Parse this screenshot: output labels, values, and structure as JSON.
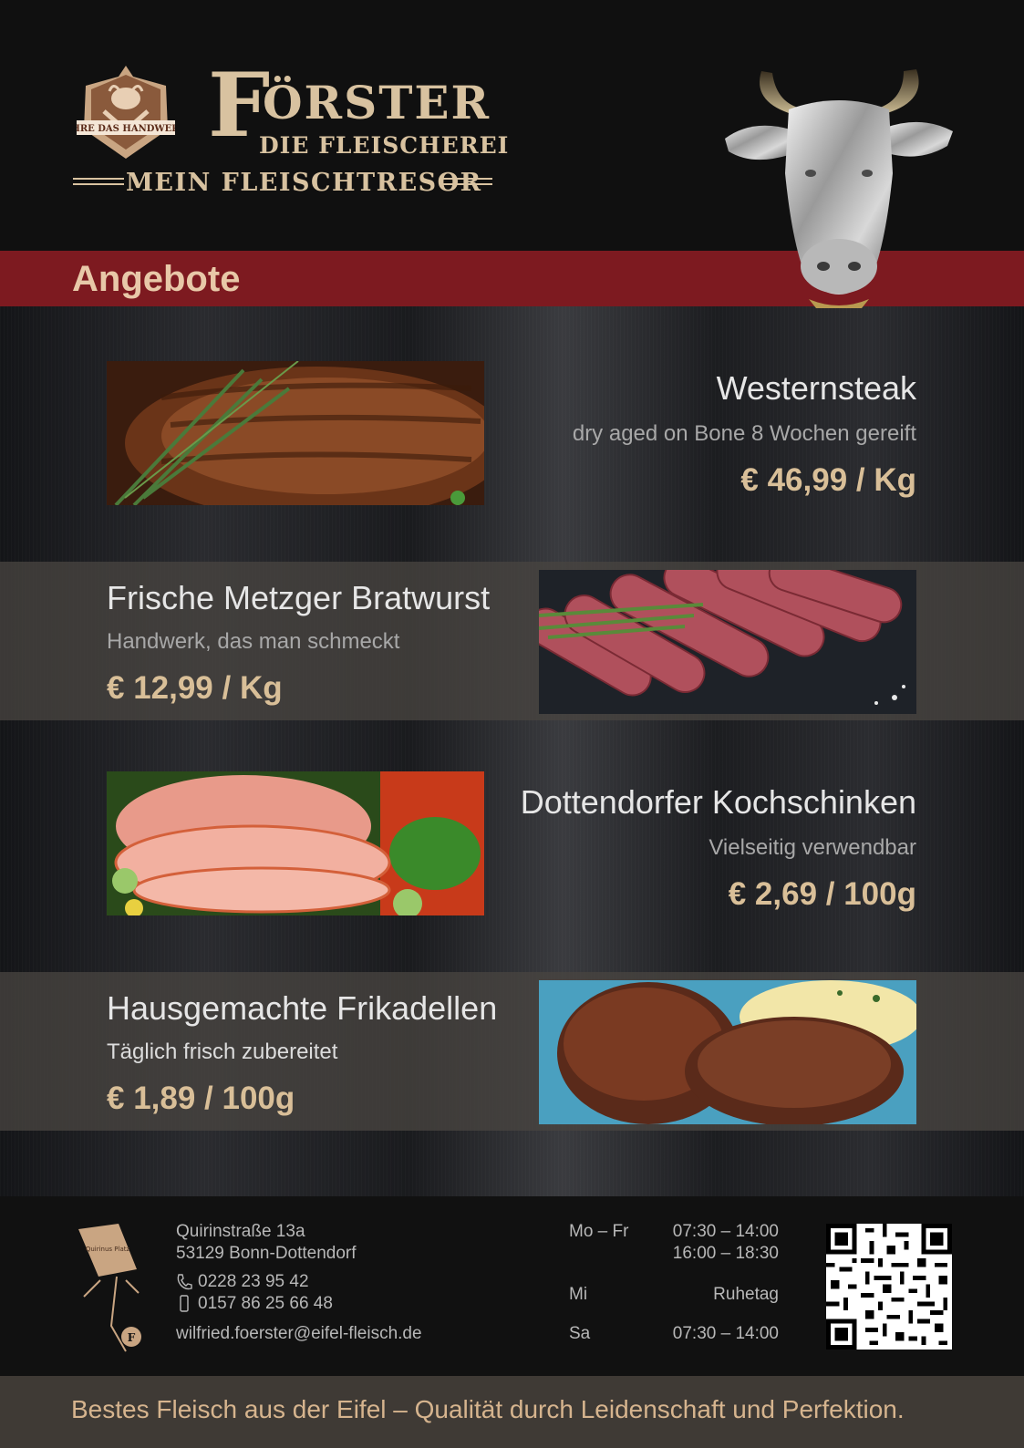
{
  "brand": {
    "name_initial": "F",
    "name_rest": "ÖRSTER",
    "subtitle": "DIE FLEISCHEREI",
    "tagline": "MEIN FLEISCHTRESOR",
    "crest_text": "EHRE DAS HANDWERK",
    "primary_color": "#101010",
    "accent_color": "#7d1a20",
    "gold_color": "#d8c2a0"
  },
  "banner": {
    "title": "Angebote"
  },
  "offers": [
    {
      "name": "Westernsteak",
      "description": "dry aged on Bone 8 Wochen gereift",
      "price": "€ 46,99 / Kg",
      "image": "steak-photo"
    },
    {
      "name": "Frische Metzger Bratwurst",
      "description": "Handwerk, das man schmeckt",
      "price": "€ 12,99 / Kg",
      "image": "sausage-photo"
    },
    {
      "name": "Dottendorfer Kochschinken",
      "description": "Vielseitig verwendbar",
      "price": "€ 2,69 / 100g",
      "image": "ham-photo"
    },
    {
      "name": "Hausgemachte Frikadellen",
      "description": "Täglich frisch zubereitet",
      "price": "€ 1,89 / 100g",
      "image": "meatball-photo"
    }
  ],
  "contact": {
    "street": "Quirinstraße 13a",
    "city": "53129 Bonn-Dottendorf",
    "phone": "0228  23 95 42",
    "mobile": "0157  86 25 66 48",
    "email": "wilfried.foerster@eifel-fleisch.de",
    "logo_text": "Quirinus Platz",
    "logo_badge": "F"
  },
  "hours": {
    "weekdays_label": "Mo – Fr",
    "weekdays_morning": "07:30 – 14:00",
    "weekdays_afternoon": "16:00 – 18:30",
    "wednesday_label": "Mi",
    "wednesday_value": "Ruhetag",
    "saturday_label": "Sa",
    "saturday_value": "07:30 – 14:00"
  },
  "footer": {
    "slogan": "Bestes Fleisch aus der Eifel  –  Qualität durch Leidenschaft und Perfektion."
  }
}
